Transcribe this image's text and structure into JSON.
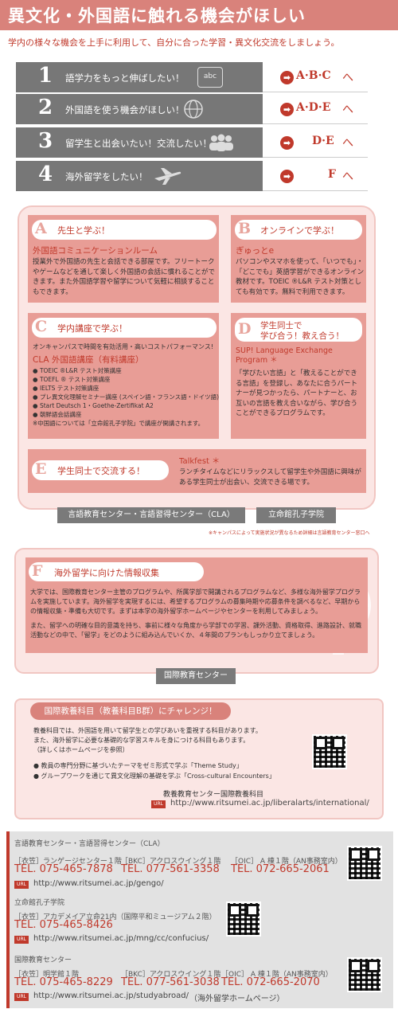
{
  "header": {
    "title": "異文化・外国語に触れる機会がほしい",
    "subtitle": "学内の様々な機会を上手に利用して、自分に合った学習・異文化交流をしましょう。"
  },
  "rows": [
    {
      "num": "1",
      "text": "語学力をもっと伸ばしたい！",
      "icon": "abc-board-icon",
      "icon_text": "abc",
      "dest": "A·B·C",
      "suffix": "へ"
    },
    {
      "num": "2",
      "text": "外国語を使う機会がほしい！",
      "icon": "globe-icon",
      "dest": "A·D·E",
      "suffix": "へ"
    },
    {
      "num": "3",
      "text": "留学生と出会いたい！交流したい！",
      "icon": "people-icon",
      "dest": "D·E",
      "suffix": "へ"
    },
    {
      "num": "4",
      "text": "海外留学をしたい！",
      "icon": "airplane-icon",
      "dest": "F",
      "suffix": "へ"
    }
  ],
  "sections": {
    "a": {
      "letter": "A",
      "title": "先生と学ぶ！",
      "subtitle": "外国語コミュニケーションルーム",
      "body": "授業外で外国語の先生と会話できる部屋です。フリートークやゲームなどを通して楽しく外国語の会話に慣れることができます。また外国語学習や留学について気軽に相談することもできます。"
    },
    "b": {
      "letter": "B",
      "title": "オンラインで学ぶ！",
      "subtitle": "ぎゅっとe",
      "body": "パソコンやスマホを使って、「いつでも」・「どこでも」英語学習ができるオンライン教材です。TOEIC ®L&R テスト対策としても有効です。無料で利用できます。"
    },
    "c": {
      "letter": "C",
      "title": "学内講座で学ぶ！",
      "intro": "オンキャンパスで時間を有効活用・高いコストパフォーマンス!",
      "subtitle": "CLA 外国語講座（有料講座）",
      "items": [
        "TOEIC ®L&R テスト対策講座",
        "TOEFL ® テスト対策講座",
        "IELTS テスト対策講座",
        "プレ異文化理解セミナー講座 (スペイン語・フランス語・ドイツ語)",
        "Start Deutsch 1・Goethe-Zertifikat A2",
        "朝鮮語会話講座"
      ],
      "note": "※中国語については「立命館孔子学院」で講座が開講されます。"
    },
    "d": {
      "letter": "D",
      "title_line1": "学生同士で",
      "title_line2": "学び合う！教え合う！",
      "subtitle": "SUP! Language Exchange Program ＊",
      "body": "「学びたい言語」と「教えることができる言語」を登録し、あなたに合うパートナーが見つかったら、パートナーと、お互いの言語を教え合いながら、学び合うことができるプログラムです。"
    },
    "e": {
      "letter": "E",
      "title": "学生同士で交流する！",
      "subtitle": "Talkfest ＊",
      "body": "ランチタイムなどにリラックスして留学生や外国語に興味がある学生同士が出会い、交流できる場です。"
    }
  },
  "tags": {
    "cla": "言語教育センター・言語習得センター（CLA）",
    "confucius": "立命館孔子学院",
    "intl": "国際教育センター"
  },
  "panel_note": "※キャンパスによって実施状況が異なるため詳細は言語教育センター窓口へ",
  "f": {
    "letter": "F",
    "title": "海外留学に向けた情報収集",
    "body1": "大学では、国際教育センター主管のプログラムや、所属学部で開講されるプログラムなど、多様な海外留学プログラムを実施しています。海外留学を実現するには、希望するプログラムの募集時期や応募条件を調べるなど、早期からの情報収集・準備も大切です。まずは本学の海外留学ホームページやセンターを利用してみましょう。",
    "body2": "また、留学への明確な目的意識を持ち、事前に様々な角度から学部での学習、課外活動、資格取得、進路設計、就職活動などの中で、「留学」をどのように組み込んでいくか、４年間のプランもしっかり立てましょう。"
  },
  "challenge": {
    "title": "国際教養科目（教養科目B群）にチャレンジ！",
    "body": [
      "教養科目では、外国語を用いて留学生との学びあいを重視する科目があります。",
      "また、海外留学に必要な基礎的な学習スキルを身につける科目もあります。",
      "（詳しくはホームページを参照）"
    ],
    "bullets": [
      "教員の専門分野に基づいたテーマをゼミ形式で学ぶ「Theme Study」",
      "グループワークを通じて異文化理解の基礎を学ぶ「Cross-cultural Encounters」"
    ],
    "site_label": "教養教育センター国際教養科目",
    "url_tag": "URL",
    "url": "http://www.ritsumei.ac.jp/liberalarts/international/"
  },
  "contacts": [
    {
      "name": "言語教育センター・言語習得センター（CLA）",
      "places": [
        {
          "loc": "［衣笠］ランゲージセンター１階",
          "tel": "TEL. 075-465-7878"
        },
        {
          "loc": "［BKC］アクロスウイング１階",
          "tel": "TEL. 077-561-3358"
        },
        {
          "loc": "［OIC］ A 棟１階（AN事務室内）",
          "tel": "TEL. 072-665-2061"
        }
      ],
      "url": "http://www.ritsumei.ac.jp/gengo/",
      "url_note": ""
    },
    {
      "name": "立命館孔子学院",
      "places": [
        {
          "loc": "［衣笠］アカデメイア立命21内（国際平和ミュージアム２階）",
          "tel": "TEL. 075-465-8426"
        }
      ],
      "url": "http://www.ritsumei.ac.jp/mng/cc/confucius/",
      "url_note": ""
    },
    {
      "name": "国際教育センター",
      "places": [
        {
          "loc": "［衣笠］明学館１階",
          "tel": "TEL. 075-465-8229"
        },
        {
          "loc": "［BKC］アクロスウイング１階",
          "tel": "TEL. 077-561-3038"
        },
        {
          "loc": "［OIC］ A 棟１階（AN事務室内）",
          "tel": "TEL. 072-665-2070"
        }
      ],
      "url": "http://www.ritsumei.ac.jp/studyabroad/",
      "url_note": "（海外留学ホームページ）"
    }
  ],
  "url_tag": "URL",
  "colors": {
    "accent": "#c0392b",
    "pink": "#e89d96",
    "panel": "#fbe6e4",
    "gray": "#777777"
  }
}
